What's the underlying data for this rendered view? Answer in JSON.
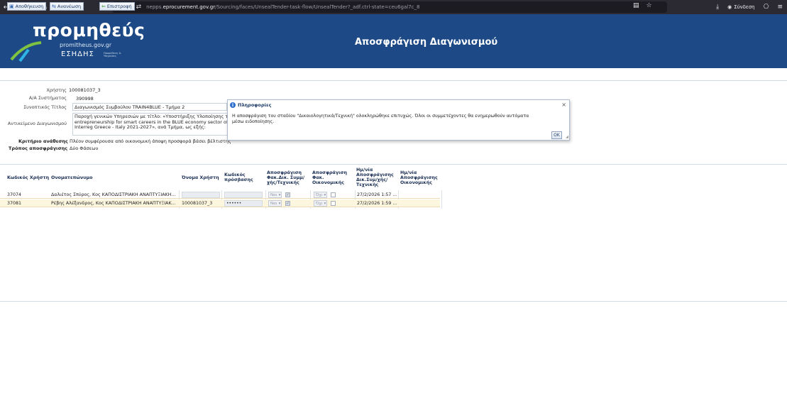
{
  "browser": {
    "back": "←",
    "forward": "→",
    "reload": "C",
    "home": "⌂",
    "url_prefix": "nepps.",
    "url_host": "eprocurement.gov.gr",
    "url_path": "/Sourcing/faces/UnsealTender-task-flow/UnsealTender?_adf.ctrl-state=ceu6gal7c_8",
    "signin": "Σύνδεση"
  },
  "header": {
    "logo_main": "προμηθεύς",
    "logo_sub": "promitheus.gov.gr",
    "logo_esidis": "ΕΣΗΔΗΣ",
    "logo_tiny": "Προμήθειες & Υπηρεσίες",
    "page_title": "Αποσφράγιση Διαγωνισμού"
  },
  "toolbar": {
    "save": "Αποθήκευση",
    "refresh": "Ανανέωση",
    "back": "Επιστροφή"
  },
  "form": {
    "user_label": "Χρήστης",
    "user_value": "100081037_3",
    "system_no_label": "Α/Α Συστήματος",
    "system_no_value": "390998",
    "short_title_label": "Συνοπτικός Τίτλος",
    "short_title_value": "Διαγωνισμός Συμβούλου TRAIN4BLUE - Τμήμα 2",
    "subject_label": "Αντικείμενο Διαγωνισμού",
    "subject_line1": "Παροχή γενικών Υπηρεσιών με τίτλο: «Υποστήριξης Υλοποίησης της Π",
    "subject_line2": "entrepreneurship for smart careers in the BLUE economy sector of th",
    "subject_line3": "Interreg Greece - Italy 2021-2027», ανά Τμήμα, ως εξής:",
    "criterion_label": "Κριτήριο ανάθεσης",
    "criterion_value": "Πλέον συμφέρουσα από οικονομική άποψη προσφορά βάσει βέλτιστης",
    "method_label": "Τρόπος αποσφράγισης",
    "method_value": "Δύο Φάσεων"
  },
  "modal": {
    "title": "Πληροφορίες",
    "close": "×",
    "message": "Η αποσφράγιση του σταδίου \"Δικαιολογητικά/Τεχνική\" ολοκληρώθηκε επιτυχώς. Όλοι οι συμμετέχοντες θα ενημερωθούν αυτόματα μέσω ειδοποίησης.",
    "ok": "OK"
  },
  "table": {
    "headers": {
      "user_code": "Κωδικός Χρήστη",
      "name": "Ονοματεπώνυμο",
      "username": "Όνομα Χρήστη",
      "password": "Κωδικός πρόσβασης",
      "unseal_tech": "Αποσφράγιση Φακ.Δικ. Συμμ/χής/Τεχνικής",
      "unseal_fin": "Αποσφράγιση Φακ. Οικονομικής",
      "date_tech": "Ημ/νία Αποσφράγισης Δικ.Συμ/χής/ Τεχνικής",
      "date_fin": "Ημ/νία Αποσφράγισης Οικονομικής"
    },
    "rows": [
      {
        "code": "37074",
        "name": "Δαλιέτος Σπύρος, Κος ΚΑΠΟΔΙΣΤΡΙΑΚΗ ΑΝΑΠΤΥΞΙΑΚΗ...",
        "username": "",
        "password": "",
        "tech_select": "Ναι",
        "tech_checked": "✓",
        "fin_select": "Όχι",
        "fin_checked": "",
        "date_tech": "27/2/2026 1:57 ..."
      },
      {
        "code": "37081",
        "name": "Ρέβης Αλέξανδρος, Κος ΚΑΠΟΔΙΣΤΡΙΑΚΗ ΑΝΑΠΤΥΞΙΑΚ...",
        "username": "100081037_3",
        "password": "••••••",
        "tech_select": "Ναι",
        "tech_checked": "✓",
        "fin_select": "Όχι",
        "fin_checked": "",
        "date_tech": "27/2/2026 1:59 ..."
      }
    ]
  }
}
